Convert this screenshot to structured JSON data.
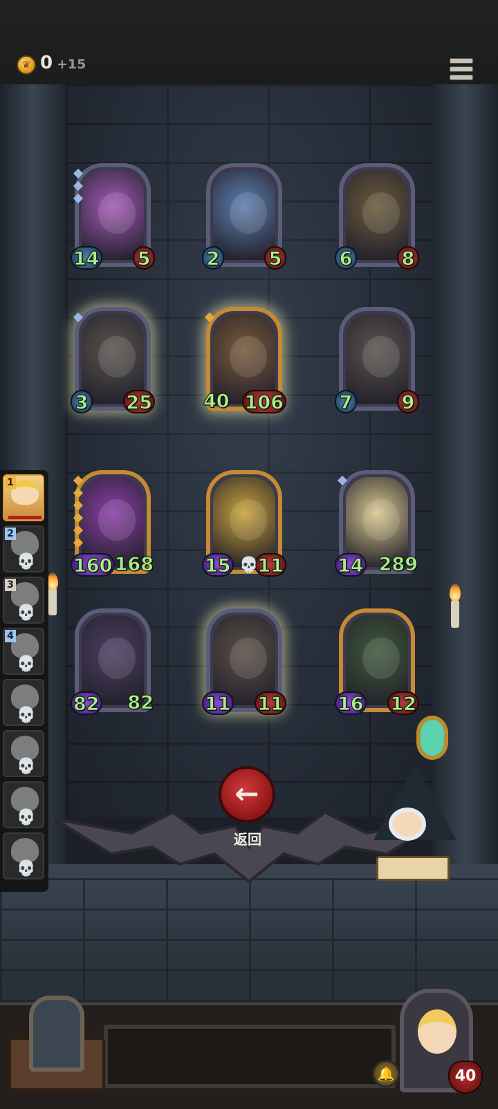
{
  "hud": {
    "gold": "0",
    "gold_gain": "+15"
  },
  "board": {
    "rows": [
      [
        {
          "id": "card-1",
          "frame": "purple",
          "atk": "14",
          "hp": "5",
          "atk_style": "blue",
          "hp_style": "red",
          "pips": [
            "blue",
            "blue",
            "blue"
          ],
          "art": "#a45ab9"
        },
        {
          "id": "card-2",
          "frame": "purple",
          "atk": "2",
          "hp": "5",
          "atk_style": "blue",
          "hp_style": "red",
          "pips": [],
          "art": "#5e7fb0"
        },
        {
          "id": "card-3",
          "frame": "purple",
          "atk": "6",
          "hp": "8",
          "atk_style": "blue",
          "hp_style": "red",
          "pips": [],
          "art": "#6c5b3d"
        }
      ],
      [
        {
          "id": "card-4",
          "frame": "purple",
          "atk": "3",
          "hp": "25",
          "atk_style": "blue",
          "hp_style": "red",
          "pips": [
            "blue"
          ],
          "art": "#5a5550",
          "glow": true
        },
        {
          "id": "card-5",
          "frame": "gold",
          "atk": "40",
          "hp": "106",
          "atk_style": "none",
          "hp_style": "red",
          "pips": [
            "gold"
          ],
          "art": "#7b5a3a",
          "glow": true
        },
        {
          "id": "card-6",
          "frame": "purple",
          "atk": "7",
          "hp": "9",
          "atk_style": "blue",
          "hp_style": "red",
          "pips": [],
          "art": "#5a5550"
        }
      ],
      [
        {
          "id": "card-7",
          "frame": "gold",
          "atk": "160",
          "hp": "168",
          "atk_style": "purple",
          "hp_style": "none",
          "pips": [
            "gold",
            "gold",
            "gold",
            "gold",
            "gold",
            "gold"
          ],
          "art": "#8a3fa8"
        },
        {
          "id": "card-8",
          "frame": "gold",
          "atk": "15",
          "hp": "11",
          "atk_style": "purple",
          "hp_style": "red",
          "pips": [],
          "art": "#c9a23a",
          "skull": true
        },
        {
          "id": "card-9",
          "frame": "purple",
          "atk": "14",
          "hp": "289",
          "atk_style": "purple",
          "hp_style": "none",
          "pips": [
            "blue"
          ],
          "art": "#d9c890"
        }
      ],
      [
        {
          "id": "card-10",
          "frame": "purple",
          "atk": "82",
          "hp": "82",
          "atk_style": "purple",
          "hp_style": "none",
          "pips": [],
          "art": "#4b3f62"
        },
        {
          "id": "card-11",
          "frame": "purple",
          "atk": "11",
          "hp": "11",
          "atk_style": "purple",
          "hp_style": "red",
          "pips": [],
          "art": "#5b5046",
          "glow": true
        },
        {
          "id": "card-12",
          "frame": "gold",
          "atk": "16",
          "hp": "12",
          "atk_style": "purple",
          "hp_style": "red",
          "pips": [],
          "art": "#3f5a3a"
        }
      ]
    ]
  },
  "party": [
    {
      "number": "1",
      "style": "gold",
      "active": true
    },
    {
      "number": "2",
      "style": "blue",
      "active": false
    },
    {
      "number": "3",
      "style": "grey",
      "active": false
    },
    {
      "number": "4",
      "style": "blue",
      "active": false
    },
    {
      "number": "",
      "style": "",
      "active": false
    },
    {
      "number": "",
      "style": "",
      "active": false
    },
    {
      "number": "",
      "style": "",
      "active": false
    },
    {
      "number": "",
      "style": "",
      "active": false
    }
  ],
  "back": {
    "icon": "←",
    "label": "返回"
  },
  "player": {
    "hp": "40"
  },
  "icons": {
    "skull": "💀",
    "bell": "🔔"
  }
}
